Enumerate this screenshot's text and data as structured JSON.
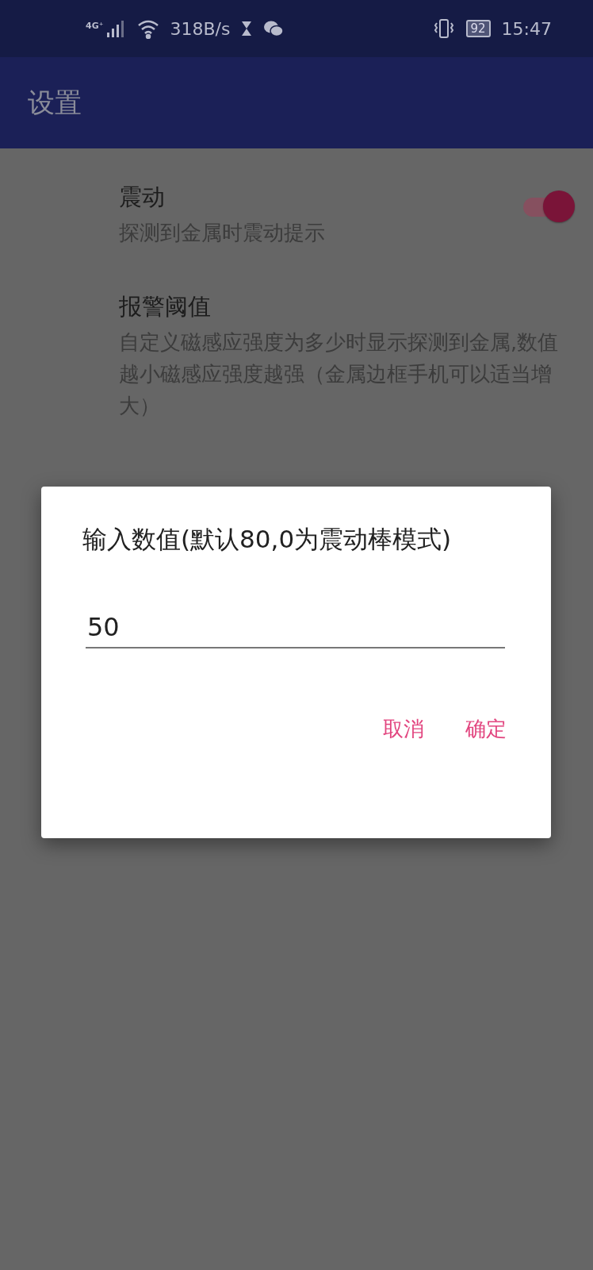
{
  "status_bar": {
    "network": "4G⁺",
    "speed": "318B/s",
    "battery": "92",
    "time": "15:47"
  },
  "app_bar": {
    "title": "设置"
  },
  "settings": [
    {
      "kind": "switch",
      "title": "震动",
      "summary": "探测到金属时震动提示",
      "on": true
    },
    {
      "kind": "text",
      "title": "报警阈值",
      "summary": "自定义磁感应强度为多少时显示探测到金属,数值越小磁感应强度越强（金属边框手机可以适当增大）"
    }
  ],
  "dialog": {
    "title": "输入数值(默认80,0为震动棒模式)",
    "value": "50",
    "buttons": [
      "取消",
      "确定"
    ]
  }
}
